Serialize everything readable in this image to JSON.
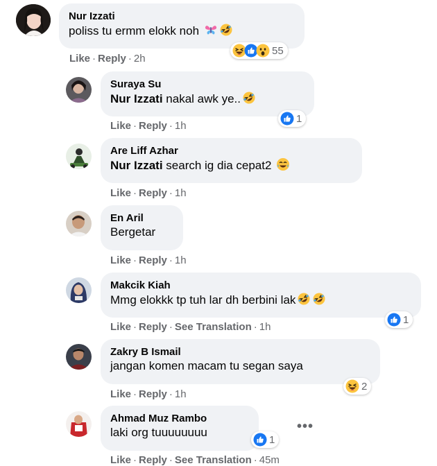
{
  "comments": [
    {
      "author": "Nur Izzati",
      "mention": "",
      "text": "poliss tu ermm elokk noh",
      "actions": [
        "Like",
        "Reply"
      ],
      "time": "2h",
      "reaction_count": "55"
    },
    {
      "author": "Suraya Su",
      "mention": "Nur Izzati",
      "text": " nakal awk ye..",
      "actions": [
        "Like",
        "Reply"
      ],
      "time": "1h",
      "reaction_count": "1"
    },
    {
      "author": "Are Liff Azhar",
      "mention": "Nur Izzati",
      "text": " search ig dia cepat2",
      "actions": [
        "Like",
        "Reply"
      ],
      "time": "1h",
      "reaction_count": ""
    },
    {
      "author": "En Aril",
      "mention": "",
      "text": "Bergetar",
      "actions": [
        "Like",
        "Reply"
      ],
      "time": "1h",
      "reaction_count": ""
    },
    {
      "author": "Makcik Kiah",
      "mention": "",
      "text": "Mmg elokkk tp tuh lar dh berbini lak",
      "actions": [
        "Like",
        "Reply",
        "See Translation"
      ],
      "time": "1h",
      "reaction_count": "1"
    },
    {
      "author": "Zakry B Ismail",
      "mention": "",
      "text": "jangan komen macam tu segan saya",
      "actions": [
        "Like",
        "Reply"
      ],
      "time": "1h",
      "reaction_count": "2"
    },
    {
      "author": "Ahmad Muz Rambo",
      "mention": "",
      "text": "laki org tuuuuuuuu",
      "actions": [
        "Like",
        "Reply",
        "See Translation"
      ],
      "time": "45m",
      "reaction_count": "1"
    }
  ],
  "icons": {
    "reaction_haha": "haha-emoji",
    "reaction_like": "like-icon",
    "reaction_wow": "wow-emoji",
    "more": "more-options-icon"
  },
  "colors": {
    "bubble": "#f0f2f5",
    "meta_text": "#65676b",
    "like_blue": "#1877f2",
    "emoji_yellow": "#fcc43f"
  }
}
